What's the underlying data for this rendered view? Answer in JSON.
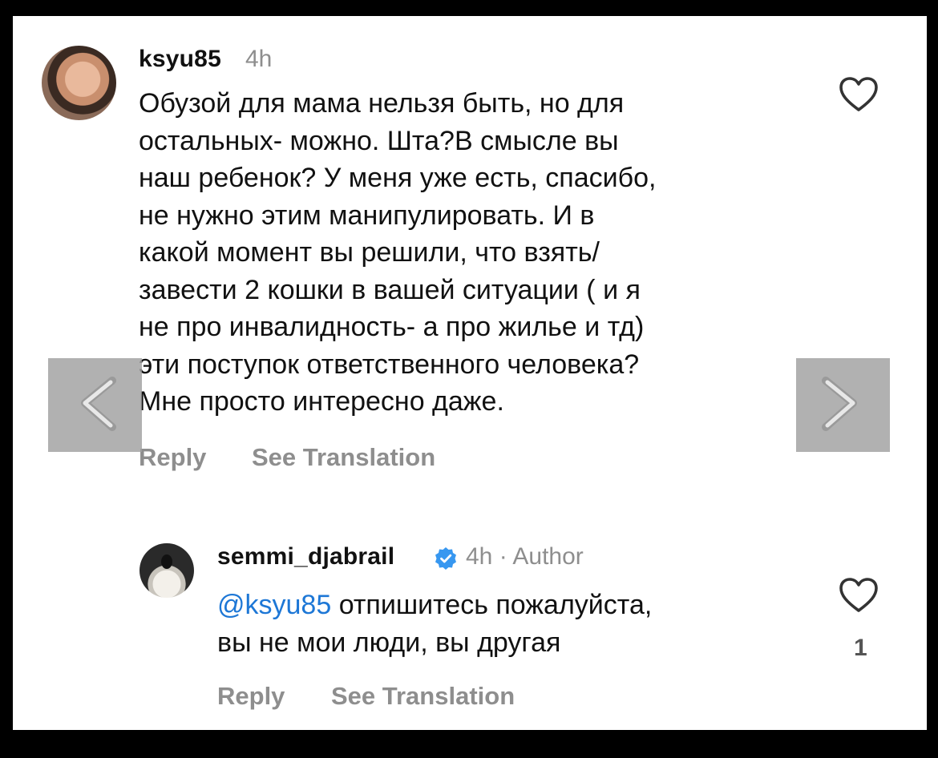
{
  "comment": {
    "username": "ksyu85",
    "time": "4h",
    "text": "Обузой для мама нельзя быть, но для\nостальных- можно. Шта?В смысле вы\nнаш ребенок?  У меня уже есть, спасибо,\nне нужно этим манипулировать. И в\nкакой момент вы решили, что взять/\nзавести 2 кошки в вашей ситуации ( и я\nне про инвалидность- а про жилье и тд)\nэти поступок ответственного человека?\nМне просто интересно даже.",
    "reply_label": "Reply",
    "translate_label": "See Translation"
  },
  "reply": {
    "username": "semmi_djabrail",
    "time": "4h · Author",
    "mention": "@ksyu85",
    "text": " отпишитесь пожалуйста,\nвы не мои люди, вы другая",
    "like_count": "1",
    "reply_label": "Reply",
    "translate_label": "See Translation"
  },
  "icons": {
    "like": "heart-outline-icon",
    "verified": "verified-badge-icon",
    "prev": "chevron-left-icon",
    "next": "chevron-right-icon"
  },
  "colors": {
    "mention": "#1d77d6",
    "verified": "#3797f0",
    "secondary_text": "#8e8e8e"
  }
}
